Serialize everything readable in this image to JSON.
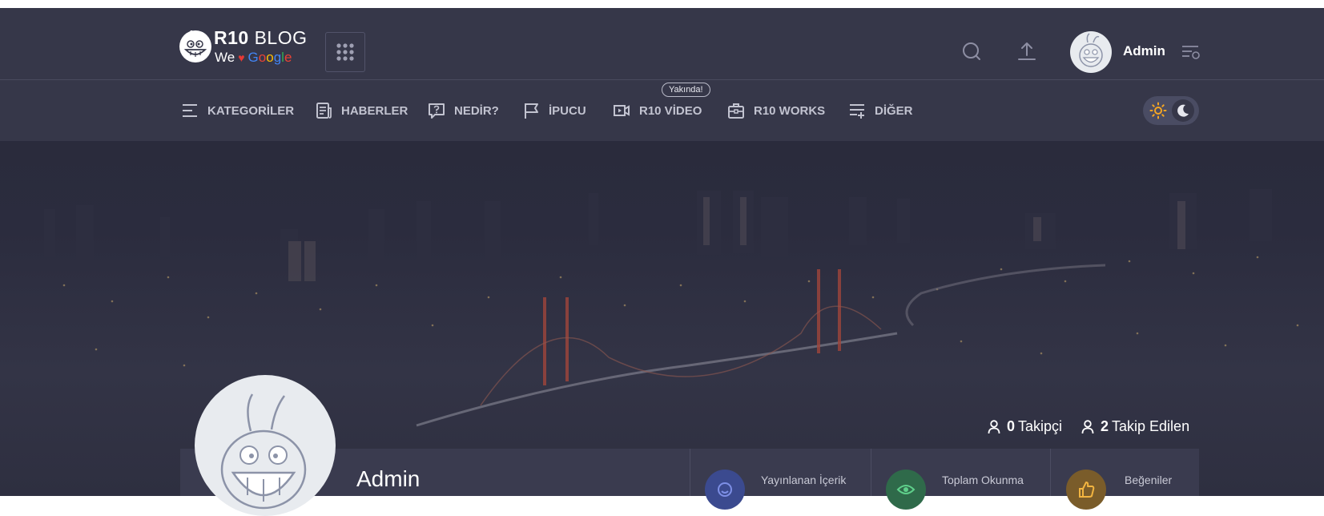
{
  "logo": {
    "brand_bold": "R10",
    "brand_light": "BLOG",
    "tagline_we": "We",
    "tagline_heart": "♥",
    "tagline_google": [
      "G",
      "o",
      "o",
      "g",
      "l",
      "e"
    ]
  },
  "header": {
    "icons": [
      "apps-grid-icon",
      "search-icon",
      "upload-icon",
      "settings-list-icon"
    ],
    "user_name": "Admin"
  },
  "nav": {
    "items": [
      {
        "label": "KATEGORİLER",
        "icon": "menu-lines-icon"
      },
      {
        "label": "HABERLER",
        "icon": "news-icon"
      },
      {
        "label": "NEDİR?",
        "icon": "question-icon"
      },
      {
        "label": "İPUCU",
        "icon": "flag-icon"
      },
      {
        "label": "R10 VİDEO",
        "icon": "video-icon"
      },
      {
        "label": "R10 WORKS",
        "icon": "briefcase-icon"
      },
      {
        "label": "DİĞER",
        "icon": "list-add-icon"
      }
    ],
    "video_badge": "Yakında!"
  },
  "theme": {
    "light_icon": "sun-icon",
    "dark_icon": "moon-icon",
    "sun_color": "#f5a623"
  },
  "profile": {
    "name": "Admin",
    "followers_count": "0",
    "followers_label": "Takipçi",
    "following_count": "2",
    "following_label": "Takip Edilen",
    "stats": [
      {
        "label": "Yayınlanan İçerik",
        "color": "#3b4a8f",
        "icon": "smile-icon"
      },
      {
        "label": "Toplam Okunma",
        "color": "#2f6a4a",
        "icon": "eye-icon"
      },
      {
        "label": "Beğeniler",
        "color": "#7a5c2a",
        "icon": "thumbs-up-icon"
      }
    ]
  },
  "colors": {
    "header_bg": "#363749",
    "nav_text": "#c2c3d0",
    "panel_bg": "#3a3b4f"
  }
}
